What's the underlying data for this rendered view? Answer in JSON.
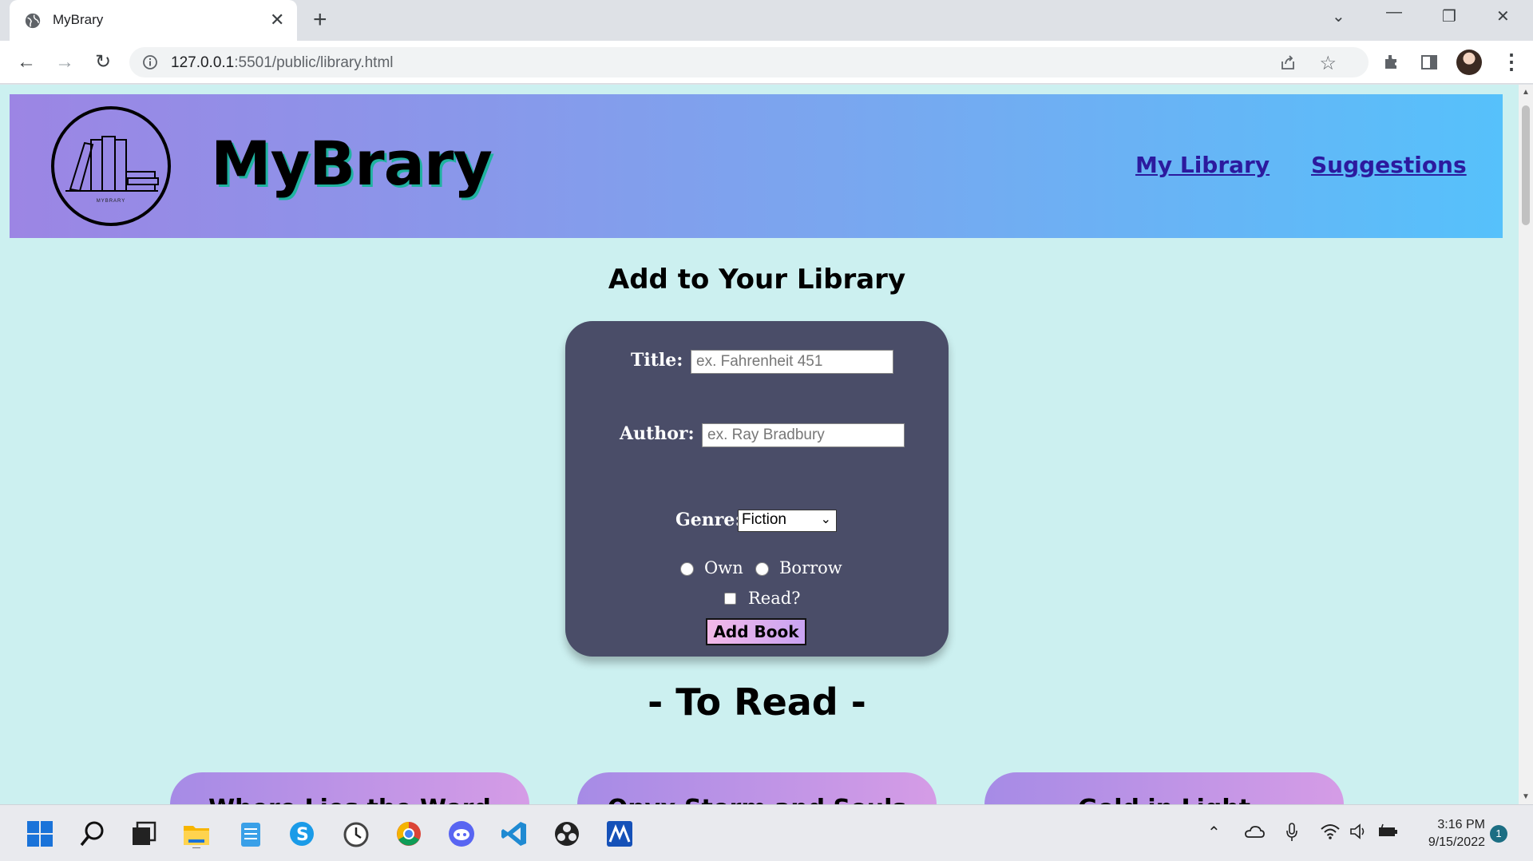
{
  "browser": {
    "tab_title": "MyBrary",
    "url_host": "127.0.0.1",
    "url_rest": ":5501/public/library.html"
  },
  "site": {
    "title": "MyBrary",
    "logo_text": "MYBRARY",
    "nav": [
      "My Library",
      "Suggestions"
    ]
  },
  "form": {
    "heading": "Add to Your Library",
    "title_label": "Title:",
    "title_placeholder": "ex. Fahrenheit 451",
    "author_label": "Author:",
    "author_placeholder": "ex. Ray Bradbury",
    "genre_label": "Genre:",
    "genre_selected": "Fiction",
    "own_label": "Own",
    "borrow_label": "Borrow",
    "read_label": "Read?",
    "submit_label": "Add Book"
  },
  "to_read": {
    "heading": "- To Read -",
    "books": [
      "Where Lies the Word",
      "Onyx Storm and Souls",
      "Gold in Light"
    ]
  },
  "taskbar": {
    "time": "3:16 PM",
    "date": "9/15/2022",
    "notifications": "1"
  },
  "colors": {
    "page_bg": "#ccf0f0",
    "header_gradient_start": "#9c85e4",
    "header_gradient_end": "#56c1fb",
    "form_bg": "#4a4d68",
    "nav_link": "#2c1a9e"
  }
}
